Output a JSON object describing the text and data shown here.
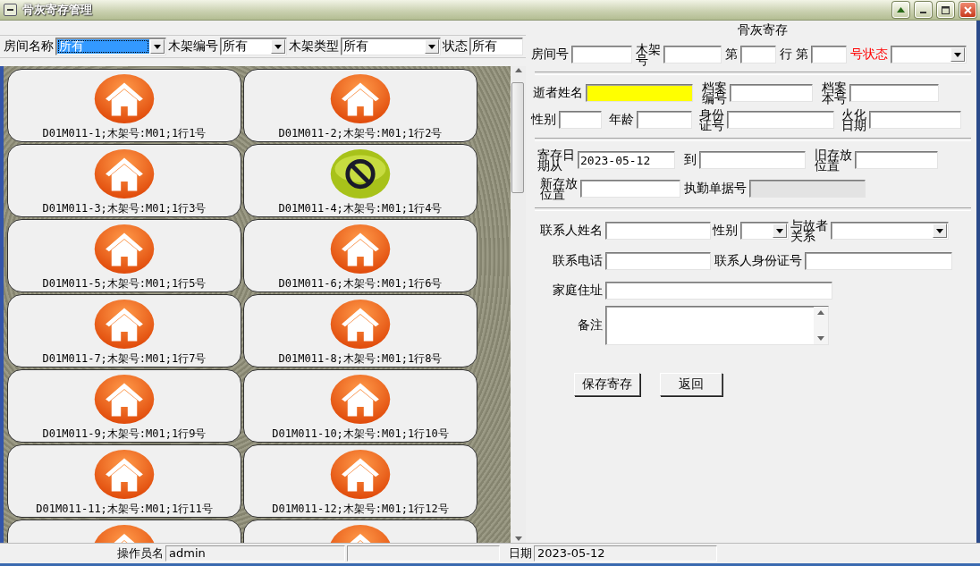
{
  "window": {
    "title": "骨灰寄存管理"
  },
  "filters": [
    {
      "label": "房间名称",
      "kind": "select",
      "value": "所有",
      "focused": true
    },
    {
      "label": "木架编号",
      "kind": "select",
      "value": "所有",
      "focused": false
    },
    {
      "label": "木架类型",
      "kind": "select",
      "value": "所有",
      "focused": false
    },
    {
      "label": "状态",
      "kind": "input",
      "value": "所有",
      "focused": false
    }
  ],
  "slots": [
    {
      "kind": "house",
      "label": "D01M011-1;木架号:M01;1行1号"
    },
    {
      "kind": "house",
      "label": "D01M011-2;木架号:M01;1行2号"
    },
    {
      "kind": "house",
      "label": "D01M011-3;木架号:M01;1行3号"
    },
    {
      "kind": "blocked",
      "label": "D01M011-4;木架号:M01;1行4号"
    },
    {
      "kind": "house",
      "label": "D01M011-5;木架号:M01;1行5号"
    },
    {
      "kind": "house",
      "label": "D01M011-6;木架号:M01;1行6号"
    },
    {
      "kind": "house",
      "label": "D01M011-7;木架号:M01;1行7号"
    },
    {
      "kind": "house",
      "label": "D01M011-8;木架号:M01;1行8号"
    },
    {
      "kind": "house",
      "label": "D01M011-9;木架号:M01;1行9号"
    },
    {
      "kind": "house",
      "label": "D01M011-10;木架号:M01;1行10号"
    },
    {
      "kind": "house",
      "label": "D01M011-11;木架号:M01;1行11号"
    },
    {
      "kind": "house",
      "label": "D01M011-12;木架号:M01;1行12号"
    },
    {
      "kind": "house"
    },
    {
      "kind": "house"
    }
  ],
  "form": {
    "title": "骨灰寄存",
    "sections": [
      {
        "lines": [
          {
            "fields": [
              {
                "label": "房间号",
                "kind": "input",
                "stacked": false
              },
              {
                "label": "木架号",
                "kind": "input",
                "stacked": true
              },
              {
                "label": "第",
                "kind": "input",
                "stacked": false
              },
              {
                "label": "行",
                "kind": "text",
                "stacked": false
              },
              {
                "label": "第",
                "kind": "input",
                "stacked": false
              },
              {
                "label": "号状态",
                "kind": "select",
                "stacked": false,
                "alert": true
              }
            ]
          }
        ]
      },
      {
        "lines": [
          {
            "fields": [
              {
                "label": "逝者姓名",
                "kind": "input",
                "stacked": false,
                "required": true
              },
              {
                "label": "档案编号",
                "kind": "input",
                "stacked": true
              },
              {
                "label": "档案本号",
                "kind": "input",
                "stacked": true
              }
            ]
          },
          {
            "fields": [
              {
                "label": "性别",
                "kind": "input",
                "stacked": false
              },
              {
                "label": "年龄",
                "kind": "input",
                "stacked": false
              },
              {
                "label": "身份证号",
                "kind": "input",
                "stacked": true
              },
              {
                "label": "火化日期",
                "kind": "input",
                "stacked": true
              }
            ]
          }
        ]
      },
      {
        "lines": [
          {
            "fields": [
              {
                "label": "寄存日期从",
                "kind": "input",
                "stacked": true,
                "value": "2023-05-12"
              },
              {
                "label": "到",
                "kind": "input",
                "stacked": false
              },
              {
                "label": "旧存放位置",
                "kind": "input",
                "stacked": true
              }
            ]
          },
          {
            "fields": [
              {
                "label": "新存放位置",
                "kind": "input",
                "stacked": true
              },
              {
                "label": "执勤单据号",
                "kind": "input",
                "stacked": false,
                "disabled": true
              }
            ]
          }
        ]
      },
      {
        "lines": [
          {
            "fields": [
              {
                "label": "联系人姓名",
                "kind": "input",
                "stacked": false
              },
              {
                "label": "性别",
                "kind": "select",
                "stacked": false
              },
              {
                "label": "与故者关系",
                "kind": "select",
                "stacked": true
              }
            ]
          },
          {
            "fields": [
              {
                "label": "联系电话",
                "kind": "input",
                "stacked": false
              },
              {
                "label": "联系人身份证号",
                "kind": "input",
                "stacked": false
              }
            ]
          },
          {
            "fields": [
              {
                "label": "家庭住址",
                "kind": "input",
                "stacked": false
              }
            ]
          },
          {
            "fields": [
              {
                "label": "备注",
                "kind": "memo",
                "stacked": false
              }
            ]
          }
        ]
      }
    ]
  },
  "buttons": [
    "保存寄存",
    "返回"
  ],
  "status_bar": {
    "operator_label": "操作员名",
    "operator": "admin",
    "date_label": "日期",
    "date": "2023-05-12"
  }
}
